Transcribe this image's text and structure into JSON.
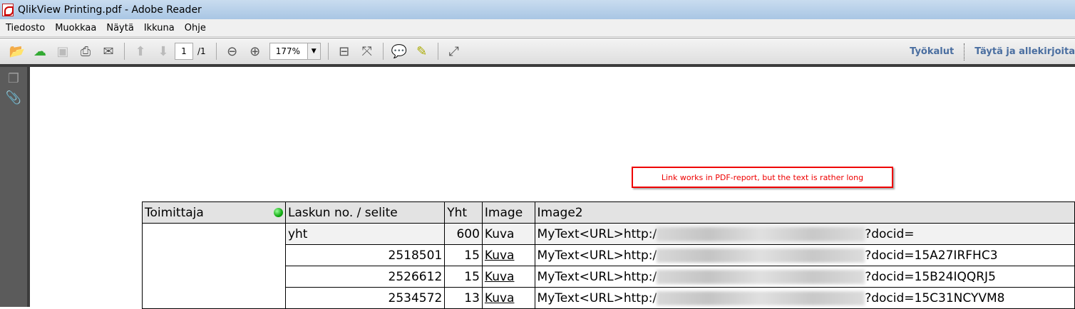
{
  "window": {
    "title": "QlikView Printing.pdf - Adobe Reader"
  },
  "menu": [
    "Tiedosto",
    "Muokkaa",
    "Näytä",
    "Ikkuna",
    "Ohje"
  ],
  "toolbar": {
    "page_current": "1",
    "page_total": "/1",
    "zoom": "177%",
    "tools_label": "Työkalut",
    "fill_sign_label": "Täytä ja allekirjoita"
  },
  "note": "Link works in PDF-report, but the text is rather long",
  "table": {
    "headers": [
      "Toimittaja",
      "Laskun no. / selite",
      "Yht",
      "Image",
      "Image2"
    ],
    "rows": [
      {
        "no": "yht",
        "yht": "600",
        "image": "Kuva",
        "prefix": "MyText<URL>http:/",
        "suffix": "?docid="
      },
      {
        "no": "2518501",
        "yht": "15",
        "image": "Kuva",
        "prefix": "MyText<URL>http:/",
        "suffix": "?docid=15A27IRFHC3"
      },
      {
        "no": "2526612",
        "yht": "15",
        "image": "Kuva",
        "prefix": "MyText<URL>http:/",
        "suffix": "?docid=15B24IQQRJ5"
      },
      {
        "no": "2534572",
        "yht": "13",
        "image": "Kuva",
        "prefix": "MyText<URL>http:/",
        "suffix": "?docid=15C31NCYVM8"
      }
    ]
  }
}
